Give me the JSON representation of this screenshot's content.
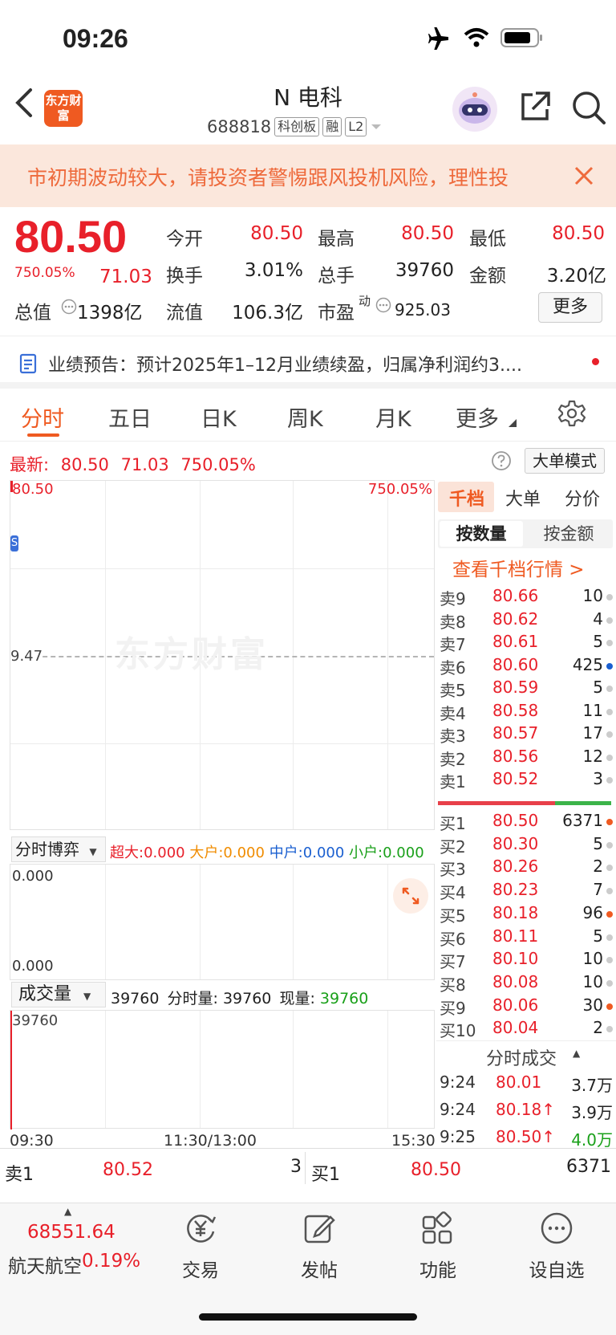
{
  "status_bar": {
    "time": "09:26"
  },
  "header": {
    "logo_text": "东方财富",
    "stock_name": "N 电科",
    "stock_code": "688818",
    "tags": [
      "科创板",
      "融",
      "L2"
    ]
  },
  "banner": {
    "text": "市初期波动较大，请投资者警惕跟风投机风险，理性投"
  },
  "quote": {
    "price": "80.50",
    "change_pct": "750.05%",
    "change": "71.03",
    "fields": [
      {
        "label": "今开",
        "value": "80.50",
        "color": "#e8202a"
      },
      {
        "label": "最高",
        "value": "80.50",
        "color": "#e8202a"
      },
      {
        "label": "最低",
        "value": "80.50",
        "color": "#e8202a"
      },
      {
        "label": "换手",
        "value": "3.01%",
        "color": "#222222"
      },
      {
        "label": "总手",
        "value": "39760",
        "color": "#222222"
      },
      {
        "label": "金额",
        "value": "3.20亿",
        "color": "#222222"
      },
      {
        "label": "总值",
        "value": "1398亿",
        "color": "#222222"
      },
      {
        "label": "流值",
        "value": "106.3亿",
        "color": "#222222"
      },
      {
        "label": "市盈",
        "value": "925.03",
        "color": "#222222"
      }
    ],
    "pe_superscript": "动",
    "more_label": "更多"
  },
  "notice": {
    "text": "业绩预告：预计2025年1–12月业绩续盈，归属净利润约3...."
  },
  "tabs": [
    "分时",
    "五日",
    "日K",
    "周K",
    "月K",
    "更多"
  ],
  "latest": {
    "label": "最新:",
    "price": "80.50",
    "change": "71.03",
    "pct": "750.05%"
  },
  "big_order_mode": "大单模式",
  "price_chart": {
    "top_price": "80.50",
    "top_pct": "750.05%",
    "mid_price": "9.47",
    "watermark": "东方财富"
  },
  "game_chart": {
    "dropdown": "分时博弈",
    "items": [
      {
        "label": "超大:",
        "value": "0.000",
        "color": "#e8202a"
      },
      {
        "label": "大户:",
        "value": "0.000",
        "color": "#f08c00"
      },
      {
        "label": "中户:",
        "value": "0.000",
        "color": "#1a5fd0"
      },
      {
        "label": "小户:",
        "value": "0.000",
        "color": "#1aa01a"
      }
    ],
    "top_val": "0.000",
    "bottom_val": "0.000"
  },
  "volume_chart": {
    "dropdown": "成交量",
    "total": "39760",
    "minute_label": "分时量:",
    "minute_val": "39760",
    "now_label": "现量:",
    "now_val": "39760",
    "top_val": "39760",
    "x_labels": [
      "09:30",
      "11:30/13:00",
      "15:30"
    ]
  },
  "right_panel": {
    "tabs": [
      "千档",
      "大单",
      "分价"
    ],
    "subtabs": [
      "按数量",
      "按金额"
    ],
    "view_link": "查看千档行情 >",
    "asks": [
      {
        "label": "卖9",
        "price": "80.66",
        "vol": "10",
        "dot": "#cccccc"
      },
      {
        "label": "卖8",
        "price": "80.62",
        "vol": "4",
        "dot": "#cccccc"
      },
      {
        "label": "卖7",
        "price": "80.61",
        "vol": "5",
        "dot": "#cccccc"
      },
      {
        "label": "卖6",
        "price": "80.60",
        "vol": "425",
        "dot": "#1a5fd0"
      },
      {
        "label": "卖5",
        "price": "80.59",
        "vol": "5",
        "dot": "#cccccc"
      },
      {
        "label": "卖4",
        "price": "80.58",
        "vol": "11",
        "dot": "#cccccc"
      },
      {
        "label": "卖3",
        "price": "80.57",
        "vol": "17",
        "dot": "#cccccc"
      },
      {
        "label": "卖2",
        "price": "80.56",
        "vol": "12",
        "dot": "#cccccc"
      },
      {
        "label": "卖1",
        "price": "80.52",
        "vol": "3",
        "dot": "#cccccc"
      }
    ],
    "bids": [
      {
        "label": "买1",
        "price": "80.50",
        "vol": "6371",
        "dot": "#ef5a21"
      },
      {
        "label": "买2",
        "price": "80.30",
        "vol": "5",
        "dot": "#cccccc"
      },
      {
        "label": "买3",
        "price": "80.26",
        "vol": "2",
        "dot": "#cccccc"
      },
      {
        "label": "买4",
        "price": "80.23",
        "vol": "7",
        "dot": "#cccccc"
      },
      {
        "label": "买5",
        "price": "80.18",
        "vol": "96",
        "dot": "#ef5a21"
      },
      {
        "label": "买6",
        "price": "80.11",
        "vol": "5",
        "dot": "#cccccc"
      },
      {
        "label": "买7",
        "price": "80.10",
        "vol": "10",
        "dot": "#cccccc"
      },
      {
        "label": "买8",
        "price": "80.08",
        "vol": "10",
        "dot": "#cccccc"
      },
      {
        "label": "买9",
        "price": "80.06",
        "vol": "30",
        "dot": "#ef5a21"
      },
      {
        "label": "买10",
        "price": "80.04",
        "vol": "2",
        "dot": "#cccccc"
      }
    ],
    "trades_title": "分时成交",
    "trades": [
      {
        "time": "9:24",
        "price": "80.01",
        "arrow": "",
        "vol": "3.7万",
        "vol_color": "#222222"
      },
      {
        "time": "9:24",
        "price": "80.18",
        "arrow": "↑",
        "vol": "3.9万",
        "vol_color": "#222222"
      },
      {
        "time": "9:25",
        "price": "80.50",
        "arrow": "↑",
        "vol": "4.0万",
        "vol_color": "#1aa01a"
      }
    ]
  },
  "book_bar": {
    "sell_label": "卖1",
    "sell_price": "80.52",
    "sell_vol": "3",
    "buy_label": "买1",
    "buy_price": "80.50",
    "buy_vol": "6371"
  },
  "bottom_nav": {
    "ticker_value": "68551.64",
    "ticker_name": "航天航空",
    "ticker_pct": "0.19%",
    "items": [
      "交易",
      "发帖",
      "功能",
      "设自选"
    ]
  }
}
